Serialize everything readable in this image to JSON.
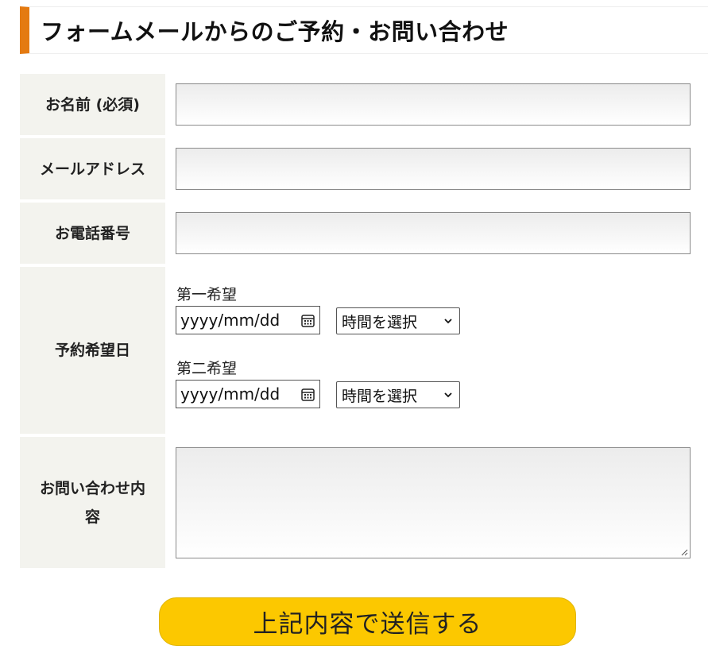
{
  "heading": {
    "title": "フォームメールからのご予約・お問い合わせ"
  },
  "fields": {
    "name_label": "お名前 (必須)",
    "email_label": "メールアドレス",
    "phone_label": "お電話番号",
    "date_label": "予約希望日",
    "message_label": "お問い合わせ内容"
  },
  "reservation": {
    "first": {
      "label": "第一希望",
      "date_placeholder": "yyyy/mm/dd",
      "time_selected": "時間を選択"
    },
    "second": {
      "label": "第二希望",
      "date_placeholder": "yyyy/mm/dd",
      "time_selected": "時間を選択"
    }
  },
  "submit": {
    "label": "上記内容で送信する"
  },
  "icons": {
    "date": "calendar-icon",
    "select": "chevron-down-icon",
    "textarea": "resize-grip-icon"
  },
  "colors": {
    "accent": "#e47a11",
    "button": "#fcc800",
    "label_bg": "#f3f3ee"
  }
}
